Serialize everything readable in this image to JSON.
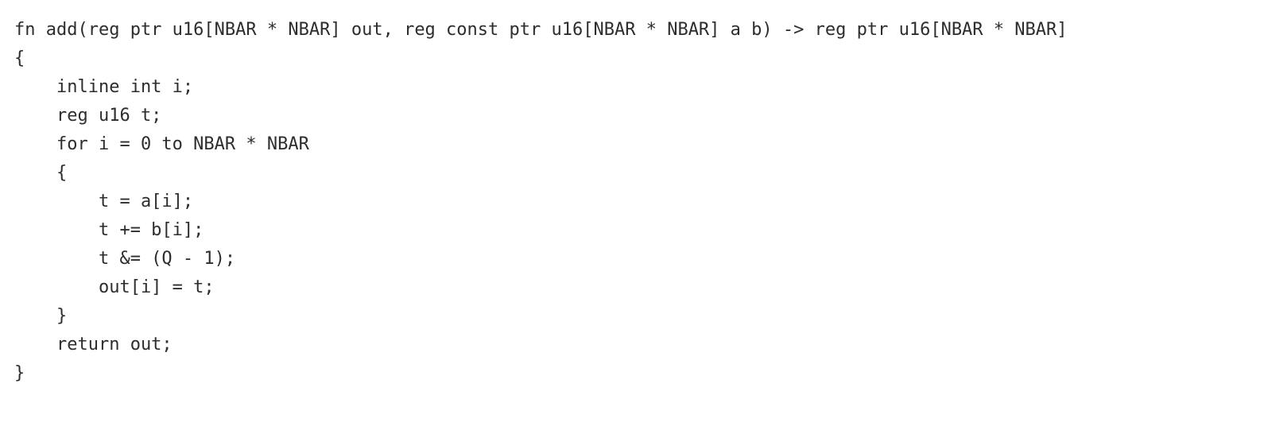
{
  "code": {
    "lines": [
      "fn add(reg ptr u16[NBAR * NBAR] out, reg const ptr u16[NBAR * NBAR] a b) -> reg ptr u16[NBAR * NBAR]",
      "{",
      "    inline int i;",
      "    reg u16 t;",
      "    for i = 0 to NBAR * NBAR",
      "    {",
      "        t = a[i];",
      "        t += b[i];",
      "        t &= (Q - 1);",
      "        out[i] = t;",
      "    }",
      "    return out;",
      "}"
    ]
  }
}
